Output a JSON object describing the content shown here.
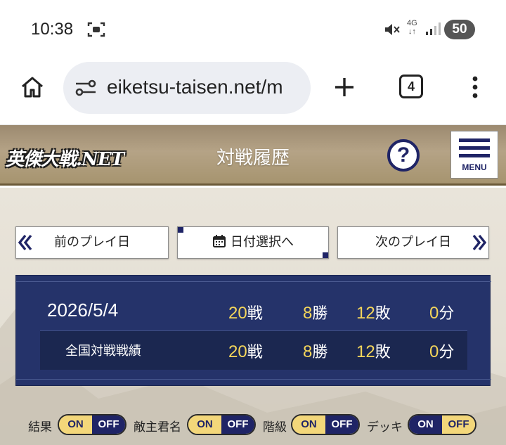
{
  "status_bar": {
    "time": "10:38",
    "network": "4G",
    "battery": "50",
    "icons": [
      "screenshot-icon",
      "mute-icon",
      "signal-icon"
    ]
  },
  "browser": {
    "url": "eiketsu-taisen.net/m",
    "tab_count": "4",
    "icons": [
      "home-icon",
      "site-settings-icon",
      "new-tab-icon",
      "more-icon"
    ]
  },
  "site": {
    "logo_text": "英傑大戦.NET",
    "title": "対戦履歴",
    "help_label": "?",
    "menu_label": "MENU",
    "accent": "#1f2466",
    "header_bg": "#a6946f"
  },
  "nav": {
    "prev": "前のプレイ日",
    "date_select": "日付選択へ",
    "next": "次のプレイ日"
  },
  "record": {
    "date": "2026/5/4",
    "day": {
      "battles": "20",
      "battles_unit": "戦",
      "wins": "8",
      "wins_unit": "勝",
      "losses": "12",
      "losses_unit": "敗",
      "draws": "0",
      "draws_unit": "分"
    },
    "national": {
      "label": "全国対戦戦績",
      "battles": "20",
      "battles_unit": "戦",
      "wins": "8",
      "wins_unit": "勝",
      "losses": "12",
      "losses_unit": "敗",
      "draws": "0",
      "draws_unit": "分"
    },
    "panel_color": "#25336a",
    "number_color": "#f4d65b"
  },
  "toggles": [
    {
      "label": "結果",
      "on": "ON",
      "off": "OFF",
      "selected": "OFF"
    },
    {
      "label": "敵主君名",
      "on": "ON",
      "off": "OFF",
      "selected": "OFF"
    },
    {
      "label": "階級",
      "on": "ON",
      "off": "OFF",
      "selected": "OFF"
    },
    {
      "label": "デッキ",
      "on": "ON",
      "off": "OFF",
      "selected": "ON"
    }
  ]
}
